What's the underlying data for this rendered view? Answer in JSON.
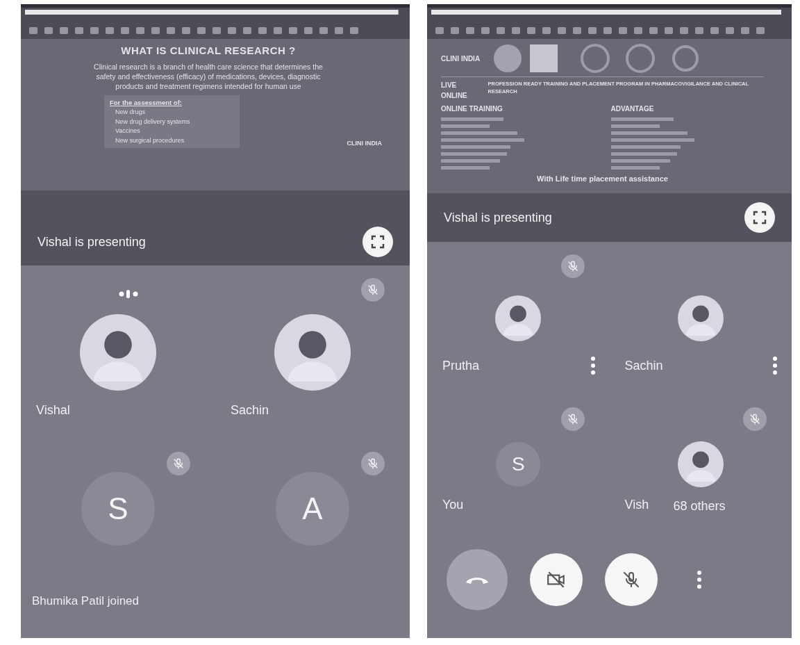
{
  "panels": [
    {
      "slide": {
        "kind": "definition",
        "title": "WHAT IS CLINICAL RESEARCH ?",
        "paragraph": "Clinical research is a branch of health care science that determines the safety and effectiveness (efficacy) of medications, devices, diagnostic products and treatment regimens intended for human use",
        "list_heading": "For the assessment of:",
        "list_items": [
          "New drugs",
          "New drug delivery systems",
          "Vaccines",
          "New surgical procedures"
        ],
        "logo": "CLINI INDIA"
      },
      "banner": "Vishal is presenting",
      "tiles": [
        {
          "kind": "photo",
          "name": "Vishal",
          "muted": false,
          "speaking": true,
          "menu": false
        },
        {
          "kind": "photo",
          "name": "Sachin",
          "muted": true,
          "speaking": false,
          "menu": false
        },
        {
          "kind": "letter",
          "initial": "S",
          "muted": true,
          "speaking": false,
          "menu": false
        },
        {
          "kind": "letter",
          "initial": "A",
          "muted": true,
          "speaking": false,
          "menu": false
        }
      ],
      "toast": "Bhumika Patil joined"
    },
    {
      "slide": {
        "kind": "brochure",
        "logo": "CLINI INDIA",
        "headline": "LIVE ONLINE",
        "tagline": "PROFESSION READY TRAINING AND PLACEMENT PROGRAM IN PHARMACOVIGILANCE AND CLINICAL RESEARCH",
        "columns": [
          "ONLINE TRAINING",
          "ADVANTAGE"
        ],
        "footer": "With Life time placement assistance"
      },
      "banner": "Vishal is presenting",
      "tiles": [
        {
          "kind": "photo",
          "name": "Prutha",
          "muted": true,
          "speaking": false,
          "menu": true
        },
        {
          "kind": "photo",
          "name": "Sachin",
          "muted": false,
          "speaking": false,
          "menu": true
        },
        {
          "kind": "letter",
          "initial": "S",
          "name": "You",
          "muted": true,
          "speaking": false,
          "menu": false
        },
        {
          "kind": "photo",
          "name": "Vish",
          "muted": true,
          "speaking": false,
          "menu": false,
          "extra": "68 others"
        }
      ],
      "controls": [
        {
          "kind": "end-call"
        },
        {
          "kind": "camera",
          "on": false
        },
        {
          "kind": "mic",
          "on": false
        },
        {
          "kind": "more"
        }
      ]
    }
  ]
}
